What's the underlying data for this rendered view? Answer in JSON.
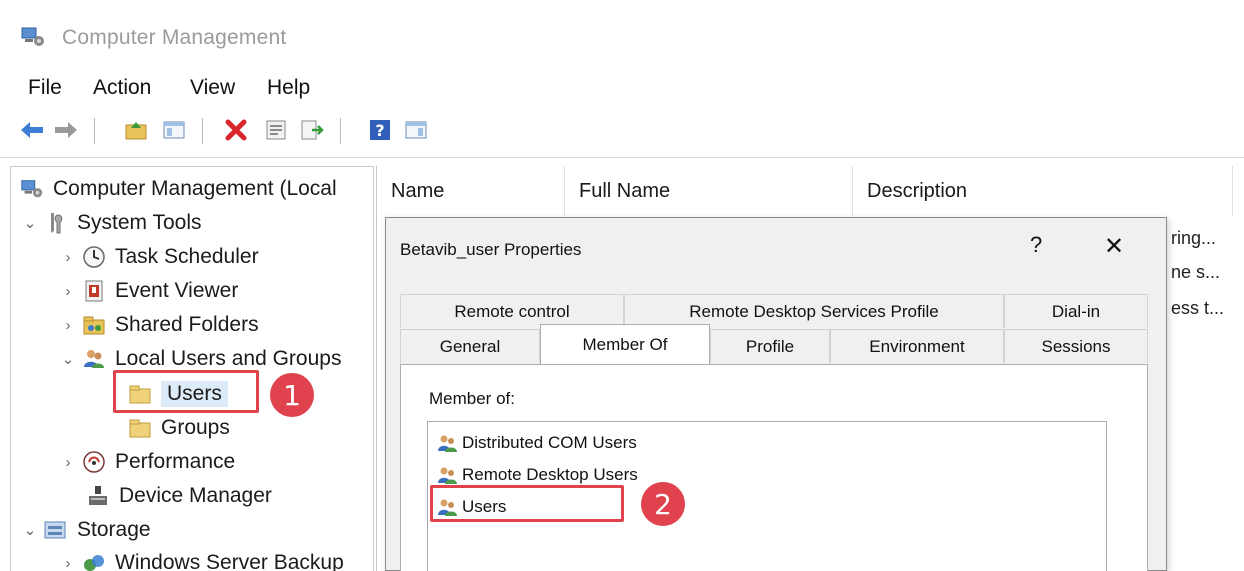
{
  "window": {
    "title": "Computer Management"
  },
  "menu": {
    "items": [
      "File",
      "Action",
      "View",
      "Help"
    ]
  },
  "toolbar": {
    "buttons": [
      "back-icon",
      "forward-icon",
      "up-folder-icon",
      "show-hide-tree-icon",
      "delete-icon",
      "properties-icon",
      "export-list-icon",
      "help-icon",
      "show-action-pane-icon"
    ]
  },
  "tree": {
    "root": "Computer Management (Local",
    "system_tools": "System Tools",
    "task_scheduler": "Task Scheduler",
    "event_viewer": "Event Viewer",
    "shared_folders": "Shared Folders",
    "local_users_groups": "Local Users and Groups",
    "users": "Users",
    "groups": "Groups",
    "performance": "Performance",
    "device_manager": "Device Manager",
    "storage": "Storage",
    "wsb": "Windows Server Backup"
  },
  "list": {
    "columns": [
      "Name",
      "Full Name",
      "Description"
    ],
    "cut_descriptions": [
      "ring...",
      "ne s...",
      "ess t..."
    ]
  },
  "dialog": {
    "title": "Betavib_user Properties",
    "help_glyph": "?",
    "close_glyph": "✕",
    "tabs_row1": [
      "Remote control",
      "Remote Desktop Services Profile",
      "Dial-in"
    ],
    "tabs_row2": [
      "General",
      "Member Of",
      "Profile",
      "Environment",
      "Sessions"
    ],
    "active_tab": "Member Of",
    "member_label": "Member of:",
    "members": [
      "Distributed COM Users",
      "Remote Desktop Users",
      "Users"
    ]
  },
  "annotations": {
    "step1": "1",
    "step2": "2",
    "color": "#e0424e"
  }
}
